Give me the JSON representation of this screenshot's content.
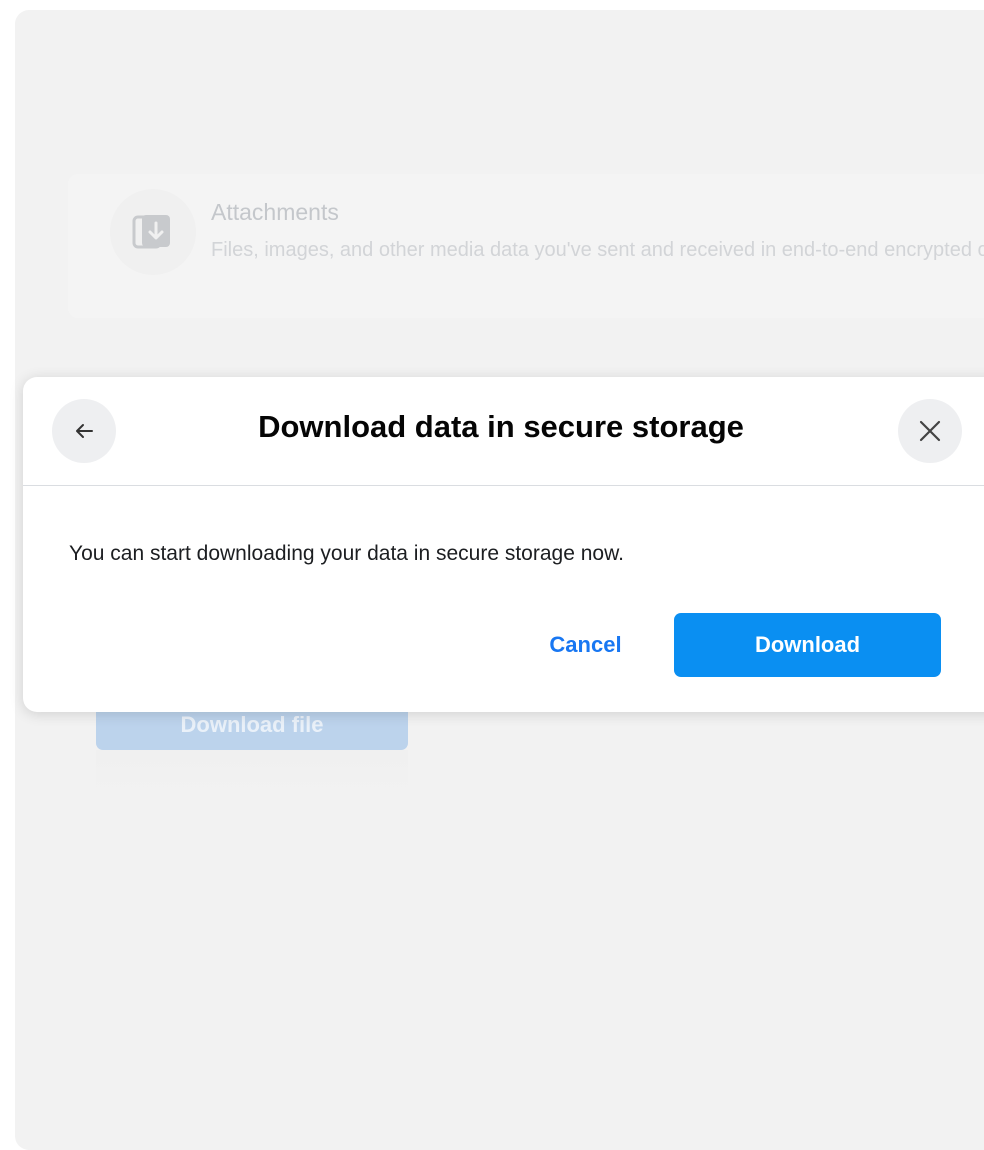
{
  "background": {
    "attachments": {
      "title": "Attachments",
      "description": "Files, images, and other media data you've sent and received in end-to-end encrypted chats.",
      "icon": "download-card-icon"
    },
    "download_file_button": "Download file"
  },
  "dialog": {
    "title": "Download data in secure storage",
    "message": "You can start downloading your data in secure storage now.",
    "back_icon": "arrow-left-icon",
    "close_icon": "close-icon",
    "cancel_label": "Cancel",
    "download_label": "Download"
  },
  "colors": {
    "accent": "#1877f2",
    "primary_button": "#0a8ff2",
    "panel_background": "#f2f2f2",
    "title_text": "#050505"
  }
}
